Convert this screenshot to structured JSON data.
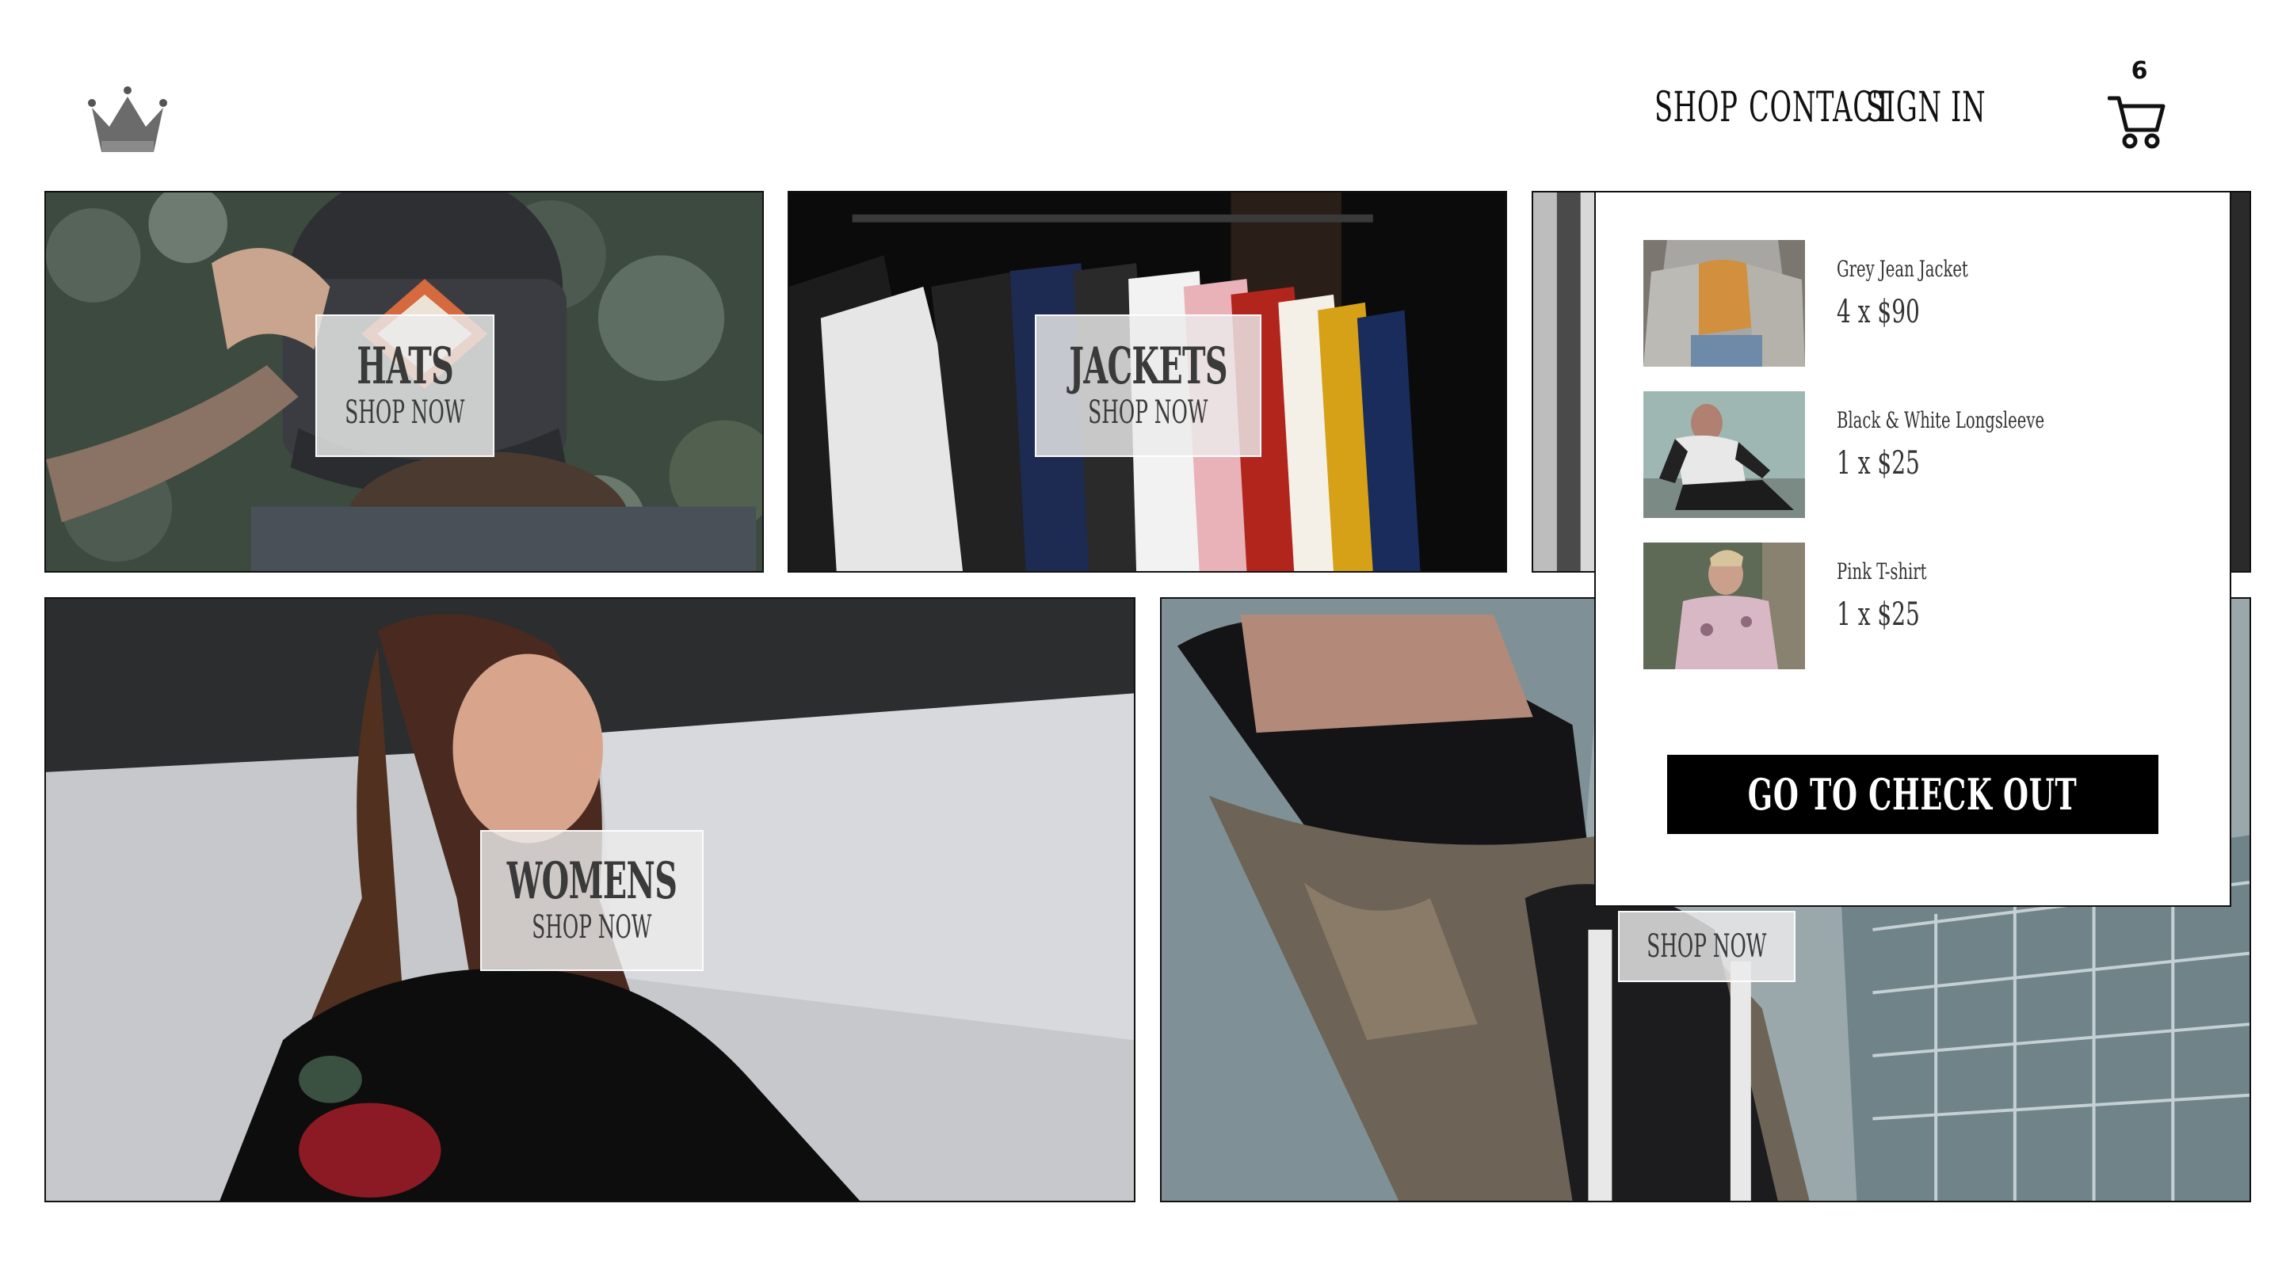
{
  "header": {
    "logo": "crown-icon",
    "nav": {
      "shop": "SHOP",
      "contact": "CONTACT",
      "sign_in": "SIGN IN"
    },
    "cart": {
      "count": "6",
      "icon": "cart-icon"
    }
  },
  "tiles": {
    "hats": {
      "title": "HATS",
      "cta": "SHOP NOW"
    },
    "jackets": {
      "title": "JACKETS",
      "cta": "SHOP NOW"
    },
    "womens": {
      "title": "WOMENS",
      "cta": "SHOP NOW"
    },
    "mens": {
      "cta": "SHOP NOW"
    }
  },
  "cart_dropdown": {
    "items": [
      {
        "name": "Grey Jean Jacket",
        "quantity_price": "4 x $90"
      },
      {
        "name": "Black & White Longsleeve",
        "quantity_price": "1 x $25"
      },
      {
        "name": "Pink T-shirt",
        "quantity_price": "1 x $25"
      }
    ],
    "checkout_label": "GO TO CHECK OUT"
  },
  "colors": {
    "accent": "#000000",
    "background": "#ffffff",
    "label_overlay": "#ebebeb"
  }
}
